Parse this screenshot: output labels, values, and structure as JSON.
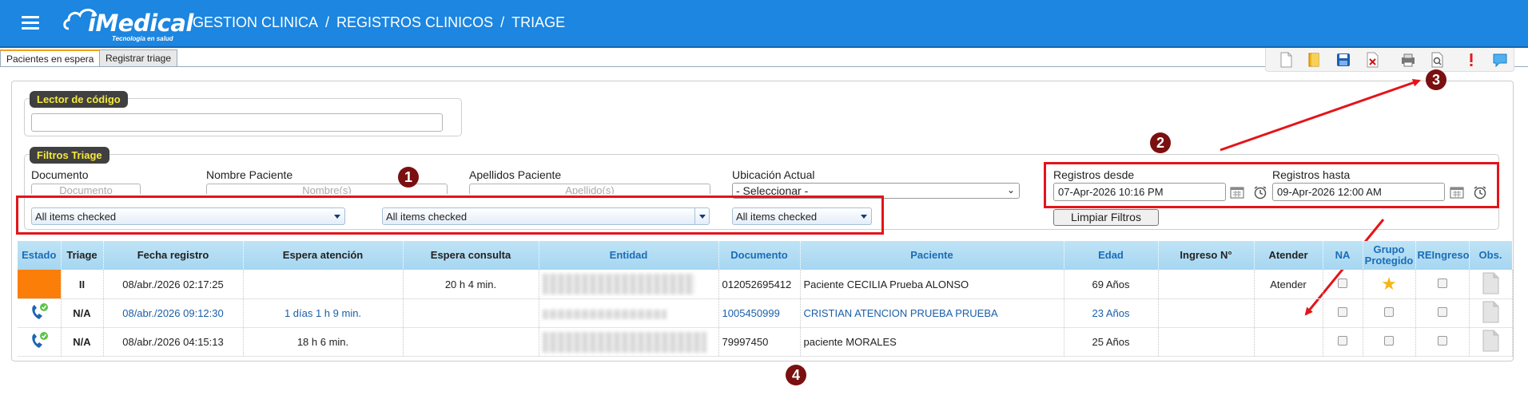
{
  "header": {
    "logo_text": "iMedical",
    "logo_tagline": "Tecnología en salud",
    "breadcrumb": [
      "GESTION CLINICA",
      "REGISTROS CLINICOS",
      "TRIAGE"
    ],
    "separator": "/"
  },
  "tabs": [
    {
      "label": "Pacientes en espera",
      "active": true
    },
    {
      "label": "Registrar triage",
      "active": false
    }
  ],
  "toolbar": {
    "icons": [
      "new-document-icon",
      "book-icon",
      "save-icon",
      "delete-icon",
      "print-icon",
      "preview-icon",
      "alert-icon",
      "comment-icon"
    ]
  },
  "lector": {
    "legend": "Lector de código",
    "value": ""
  },
  "filtros": {
    "legend": "Filtros Triage",
    "documento": {
      "label": "Documento",
      "placeholder": "Documento"
    },
    "nombre": {
      "label": "Nombre Paciente",
      "placeholder": "Nombre(s)"
    },
    "apellidos": {
      "label": "Apellidos Paciente",
      "placeholder": "Apellido(s)"
    },
    "ubicacion": {
      "label": "Ubicación Actual",
      "selected": "- Seleccionar -"
    },
    "multiselects": [
      "All items checked",
      "All items checked",
      "All items checked"
    ],
    "desde": {
      "label": "Registros desde",
      "value": "07-Apr-2026 10:16 PM"
    },
    "hasta": {
      "label": "Registros hasta",
      "value": "09-Apr-2026 12:00 AM"
    },
    "clear_button": "Limpiar Filtros"
  },
  "annotations": [
    "1",
    "2",
    "3",
    "4"
  ],
  "table": {
    "headers": [
      "Estado",
      "Triage",
      "Fecha registro",
      "Espera atención",
      "Espera consulta",
      "Entidad",
      "Documento",
      "Paciente",
      "Edad",
      "Ingreso N°",
      "Atender",
      "NA",
      "Grupo Protegido",
      "REIngreso",
      "Obs."
    ],
    "rows": [
      {
        "estado": "orange",
        "triage": "II",
        "fecha": "08/abr./2026 02:17:25",
        "espera_atencion": "",
        "espera_consulta": "20 h 4 min.",
        "documento": "012052695412",
        "paciente": "Paciente CECILIA Prueba ALONSO",
        "edad": "69 Años",
        "ingreso": "",
        "atender": "Atender",
        "grupo_protegido": true
      },
      {
        "estado": "phone",
        "triage": "N/A",
        "fecha": "08/abr./2026 09:12:30",
        "espera_atencion": "1 días 1 h 9 min.",
        "espera_consulta": "",
        "documento": "1005450999",
        "paciente": "CRISTIAN ATENCION PRUEBA PRUEBA",
        "edad": "23 Años",
        "ingreso": "",
        "atender": "",
        "grupo_protegido": false
      },
      {
        "estado": "phone",
        "triage": "N/A",
        "fecha": "08/abr./2026 04:15:13",
        "espera_atencion": "18 h 6 min.",
        "espera_consulta": "",
        "documento": "79997450",
        "paciente": "paciente MORALES",
        "edad": "25 Años",
        "ingreso": "",
        "atender": "",
        "grupo_protegido": false
      }
    ]
  },
  "colors": {
    "header_bg": "#1c86e0",
    "legend_text": "#f5e93c",
    "highlight_red": "#e4141a",
    "badge": "#7a1010",
    "estado_orange": "#fb7e08"
  }
}
